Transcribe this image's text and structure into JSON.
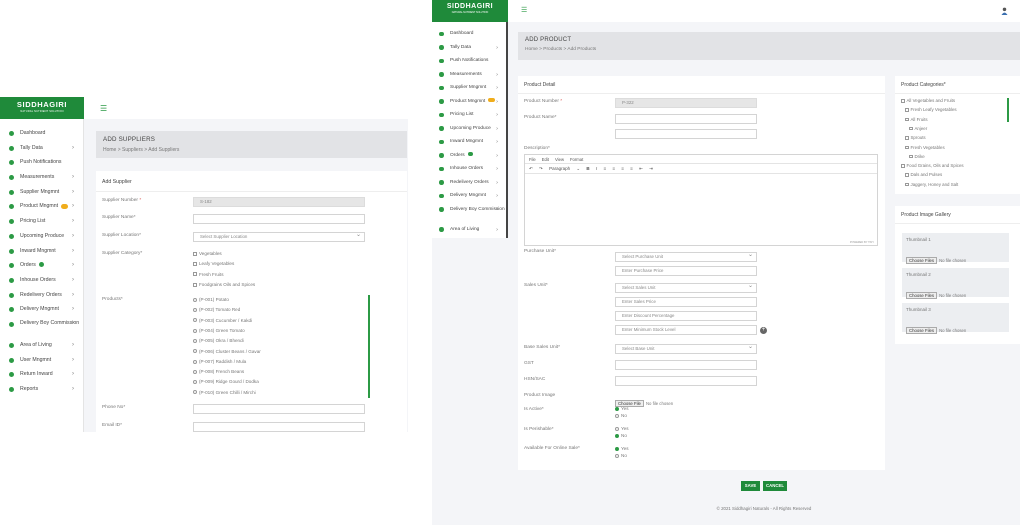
{
  "left_window": {
    "brand": {
      "name": "SIDDHAGIRI",
      "tagline": "NATURAL NUTRIENT SOLUTION"
    },
    "nav": [
      {
        "label": "Dashboard",
        "icon": "dashboard-icon",
        "chevron": false
      },
      {
        "label": "Tally Data",
        "icon": "tally-icon",
        "chevron": true
      },
      {
        "label": "Push Notifications",
        "icon": "bell-icon",
        "chevron": false
      },
      {
        "label": "Measurements",
        "icon": "ruler-icon",
        "chevron": true
      },
      {
        "label": "Supplier Mngmnt",
        "icon": "supplier-icon",
        "chevron": true
      },
      {
        "label": "Product Mngmnt",
        "icon": "product-icon",
        "chevron": true
      },
      {
        "label": "Pricing List",
        "icon": "tag-icon",
        "chevron": true
      },
      {
        "label": "Upcoming Produce",
        "icon": "clock-icon",
        "chevron": true
      },
      {
        "label": "Inward Mngmnt",
        "icon": "inbox-icon",
        "chevron": true
      },
      {
        "label": "Orders",
        "icon": "cart-icon",
        "chevron": true
      },
      {
        "label": "Inhouse Orders",
        "icon": "house-icon",
        "chevron": true
      },
      {
        "label": "Redelivery Orders",
        "icon": "refresh-icon",
        "chevron": true
      },
      {
        "label": "Delivery Mngmnt",
        "icon": "truck-icon",
        "chevron": true
      },
      {
        "label": "Delivery Boy Commission",
        "icon": "person-icon",
        "chevron": true
      },
      {
        "label": "Area of Living",
        "icon": "pin-icon",
        "chevron": true
      },
      {
        "label": "User Mngmnt",
        "icon": "user-icon",
        "chevron": true
      },
      {
        "label": "Return Inward",
        "icon": "return-icon",
        "chevron": true
      },
      {
        "label": "Reports",
        "icon": "report-icon",
        "chevron": true
      }
    ],
    "page_title": "ADD SUPPLIERS",
    "breadcrumb": "Home > Suppliers > Add Suppliers",
    "card_title": "Add Supplier",
    "form": {
      "supplier_number_label": "Supplier Number",
      "supplier_number_value": "S-182",
      "supplier_name_label": "Supplier Name*",
      "supplier_location_label": "Supplier Location*",
      "supplier_location_placeholder": "Select Supplier Location",
      "supplier_category_label": "Supplier Category*",
      "categories": [
        "Vegetables",
        "Leafy Vegetables",
        "Fresh Fruits",
        "Foodgrains Oils and Spices"
      ],
      "products_label": "Products*",
      "products": [
        "(P-001) Potato",
        "(P-002) Tomato Red",
        "(P-003) Cucumber / Kakdi",
        "(P-004) Green Tomato",
        "(P-005) Okra / Bhendi",
        "(P-006) Cluster Beans / Gavar",
        "(P-007) Raddish / Mula",
        "(P-008) French Beans",
        "(P-009) Ridge Gourd / Dodka",
        "(P-010) Green Chilli / Mirchi"
      ],
      "phone_label": "Phone No*",
      "email_label": "Email ID*"
    }
  },
  "right_window": {
    "brand": {
      "name": "SIDDHAGIRI",
      "tagline": "NATURAL NUTRIENT SOLUTION"
    },
    "nav": [
      {
        "label": "Dashboard",
        "icon": "dashboard-icon",
        "chevron": false
      },
      {
        "label": "Tally Data",
        "icon": "tally-icon",
        "chevron": true
      },
      {
        "label": "Push Notifications",
        "icon": "bell-icon",
        "chevron": false
      },
      {
        "label": "Measurements",
        "icon": "ruler-icon",
        "chevron": true
      },
      {
        "label": "Supplier Mngmnt",
        "icon": "supplier-icon",
        "chevron": true
      },
      {
        "label": "Product Mngmnt",
        "icon": "product-icon",
        "chevron": true
      },
      {
        "label": "Pricing List",
        "icon": "tag-icon",
        "chevron": true
      },
      {
        "label": "Upcoming Produce",
        "icon": "clock-icon",
        "chevron": true
      },
      {
        "label": "Inward Mngmnt",
        "icon": "inbox-icon",
        "chevron": true
      },
      {
        "label": "Orders",
        "icon": "cart-icon",
        "chevron": true
      },
      {
        "label": "Inhouse Orders",
        "icon": "house-icon",
        "chevron": true
      },
      {
        "label": "Redelivery Orders",
        "icon": "refresh-icon",
        "chevron": true
      },
      {
        "label": "Delivery Mngmnt",
        "icon": "truck-icon",
        "chevron": true
      },
      {
        "label": "Delivery Boy Commission",
        "icon": "person-icon",
        "chevron": true
      },
      {
        "label": "Area of Living",
        "icon": "pin-icon",
        "chevron": true
      }
    ],
    "page_title": "ADD PRODUCT",
    "breadcrumb": "Home > Products > Add Products",
    "card_title": "Product Detail",
    "form": {
      "product_number_label": "Product Number",
      "product_number_value": "P-322",
      "product_name_label": "Product Name*",
      "description_label": "Description*",
      "editor_menu": [
        "File",
        "Edit",
        "View",
        "Format"
      ],
      "editor_paragraph": "Paragraph",
      "editor_footer": "POWERED BY TINY",
      "purchase_unit_label": "Purchase Unit*",
      "purchase_unit_placeholder": "Select Purchase Unit",
      "purchase_price_placeholder": "Enter Purchase Price",
      "sales_unit_label": "Sales Unit*",
      "sales_unit_placeholder": "Select Sales Unit",
      "sales_price_placeholder": "Enter Sales Price",
      "discount_placeholder": "Enter Discount Percentage",
      "min_stock_placeholder": "Enter Minimum Stock Level",
      "base_sales_unit_label": "Base Sales Unit*",
      "base_unit_placeholder": "Select Base Unit",
      "gst_label": "GST",
      "hsn_label": "HSN/SAC",
      "product_image_label": "Product Image",
      "choose_file": "Choose File",
      "no_file": "No file chosen",
      "is_active_label": "Is Active*",
      "is_perishable_label": "Is Perishable*",
      "online_sale_label": "Available For Online Sale*",
      "yes": "Yes",
      "no": "No"
    },
    "categories_title": "Product Categories*",
    "category_tree": [
      {
        "label": "All Vegetables and Fruits",
        "level": 0
      },
      {
        "label": "Fresh Leafy Vegetables",
        "level": 1
      },
      {
        "label": "All Fruits",
        "level": 1
      },
      {
        "label": "Anjeer",
        "level": 2
      },
      {
        "label": "Sprouts",
        "level": 1
      },
      {
        "label": "Fresh Vegetables",
        "level": 1
      },
      {
        "label": "Drike",
        "level": 2
      },
      {
        "label": "Food Grains, Oils and Spices",
        "level": 0
      },
      {
        "label": "Dals and Pulses",
        "level": 1
      },
      {
        "label": "Jaggery, Honey and Salt",
        "level": 1
      }
    ],
    "gallery_title": "Product Image Gallery",
    "thumbnails": [
      "Thumbnail 1",
      "Thumbnail 2",
      "Thumbnail 3"
    ],
    "choose_files": "Choose Files",
    "save_label": "SAVE",
    "cancel_label": "CANCEL",
    "footer": "© 2021 Siddhagiri Naturals - All Rights Reserved"
  },
  "colors": {
    "brand_green": "#1f8a3a",
    "accent_green": "#2c9a45",
    "badge_orange": "#f0ad1c"
  }
}
